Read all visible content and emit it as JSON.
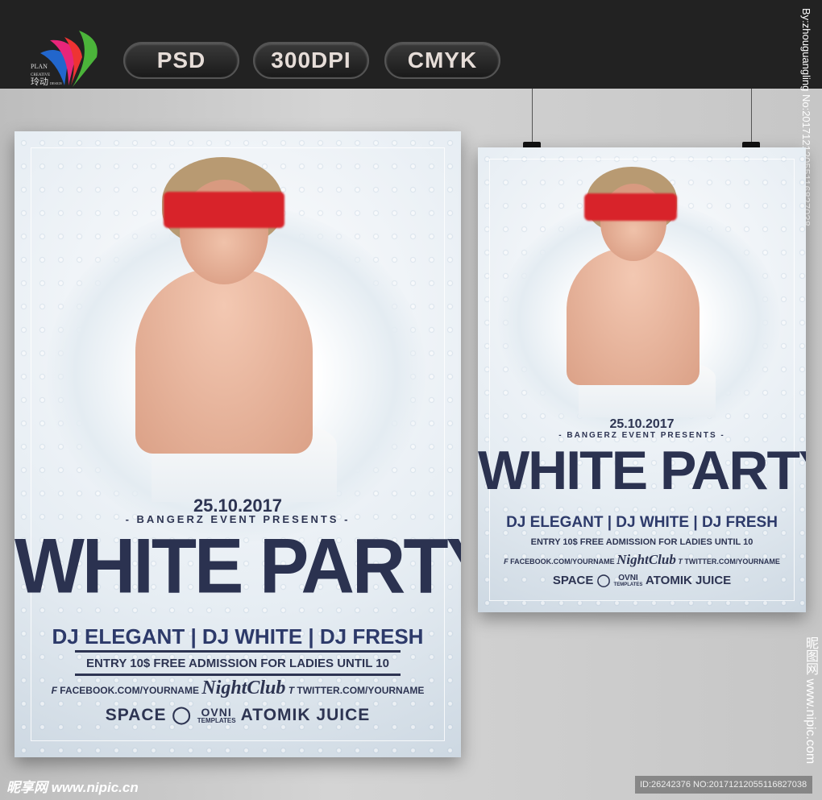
{
  "header": {
    "logo_text": [
      "PLAN",
      "CREATIVE",
      "玲动",
      "DESIGN"
    ],
    "badges": [
      "PSD",
      "300DPI",
      "CMYK"
    ]
  },
  "watermarks": {
    "right_top": "By:zhouguangling No:20171212055116827038",
    "right_bottom": "昵图网 www.nipic.com",
    "bottom_left": "昵享网 www.nipic.cn",
    "bottom_right": "ID:26242376 NO:20171212055116827038"
  },
  "poster": {
    "date": "25.10.2017",
    "presents": "BANGERZ EVENT PRESENTS",
    "title": "WHITE PARTY",
    "djs": "DJ ELEGANT | DJ WHITE | DJ FRESH",
    "entry": "ENTRY 10$ FREE ADMISSION FOR LADIES UNTIL 10",
    "facebook": "FACEBOOK.COM/YOURNAME",
    "club": "NightClub",
    "twitter": "TWITTER.COM/YOURNAME",
    "sponsors": [
      "SPACE",
      "OVNI",
      "TEMPLATES",
      "ATOMIK",
      "JUICE"
    ]
  },
  "colors": {
    "topbar": "#222222",
    "text": "#2d3452",
    "mask": "#d8232a"
  }
}
